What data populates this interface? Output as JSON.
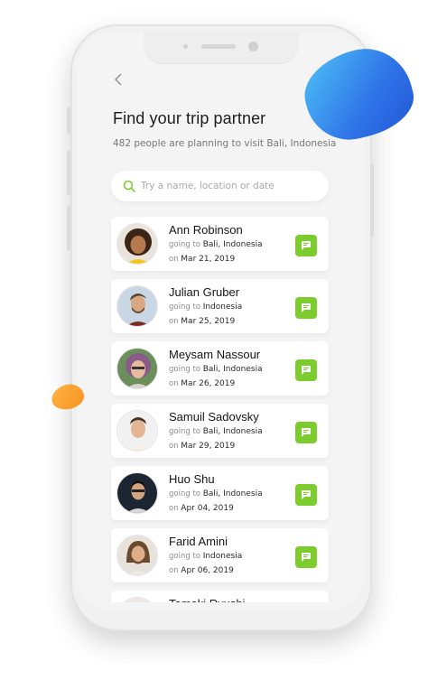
{
  "header": {
    "back_icon": "chevron-left-icon",
    "title": "Find your trip partner",
    "subtitle": "482 people are planning to visit Bali, Indonesia"
  },
  "search": {
    "icon": "search-icon",
    "placeholder": "Try a name, location or date",
    "value": ""
  },
  "labels": {
    "going_to": "going to",
    "on": "on"
  },
  "colors": {
    "accent_green": "#7ccc2e",
    "blob_blue": "#2f74e8",
    "blob_orange": "#f7931e"
  },
  "partners": [
    {
      "name": "Ann Robinson",
      "destination": "Bali, Indonesia",
      "date": "Mar 21, 2019",
      "action_icon": "chat-icon"
    },
    {
      "name": "Julian Gruber",
      "destination": "Indonesia",
      "date": "Mar 25, 2019",
      "action_icon": "chat-icon"
    },
    {
      "name": "Meysam Nassour",
      "destination": "Bali, Indonesia",
      "date": "Mar 26, 2019",
      "action_icon": "chat-icon"
    },
    {
      "name": "Samuil Sadovsky",
      "destination": "Bali, Indonesia",
      "date": "Mar 29, 2019",
      "action_icon": "chat-icon"
    },
    {
      "name": "Huo Shu",
      "destination": "Bali, Indonesia",
      "date": "Apr 04, 2019",
      "action_icon": "chat-icon"
    },
    {
      "name": "Farid Amini",
      "destination": "Indonesia",
      "date": "Apr 06, 2019",
      "action_icon": "chat-icon"
    },
    {
      "name": "Tamaki Ryushi",
      "destination": "",
      "date": "",
      "action_icon": "chat-icon"
    }
  ]
}
